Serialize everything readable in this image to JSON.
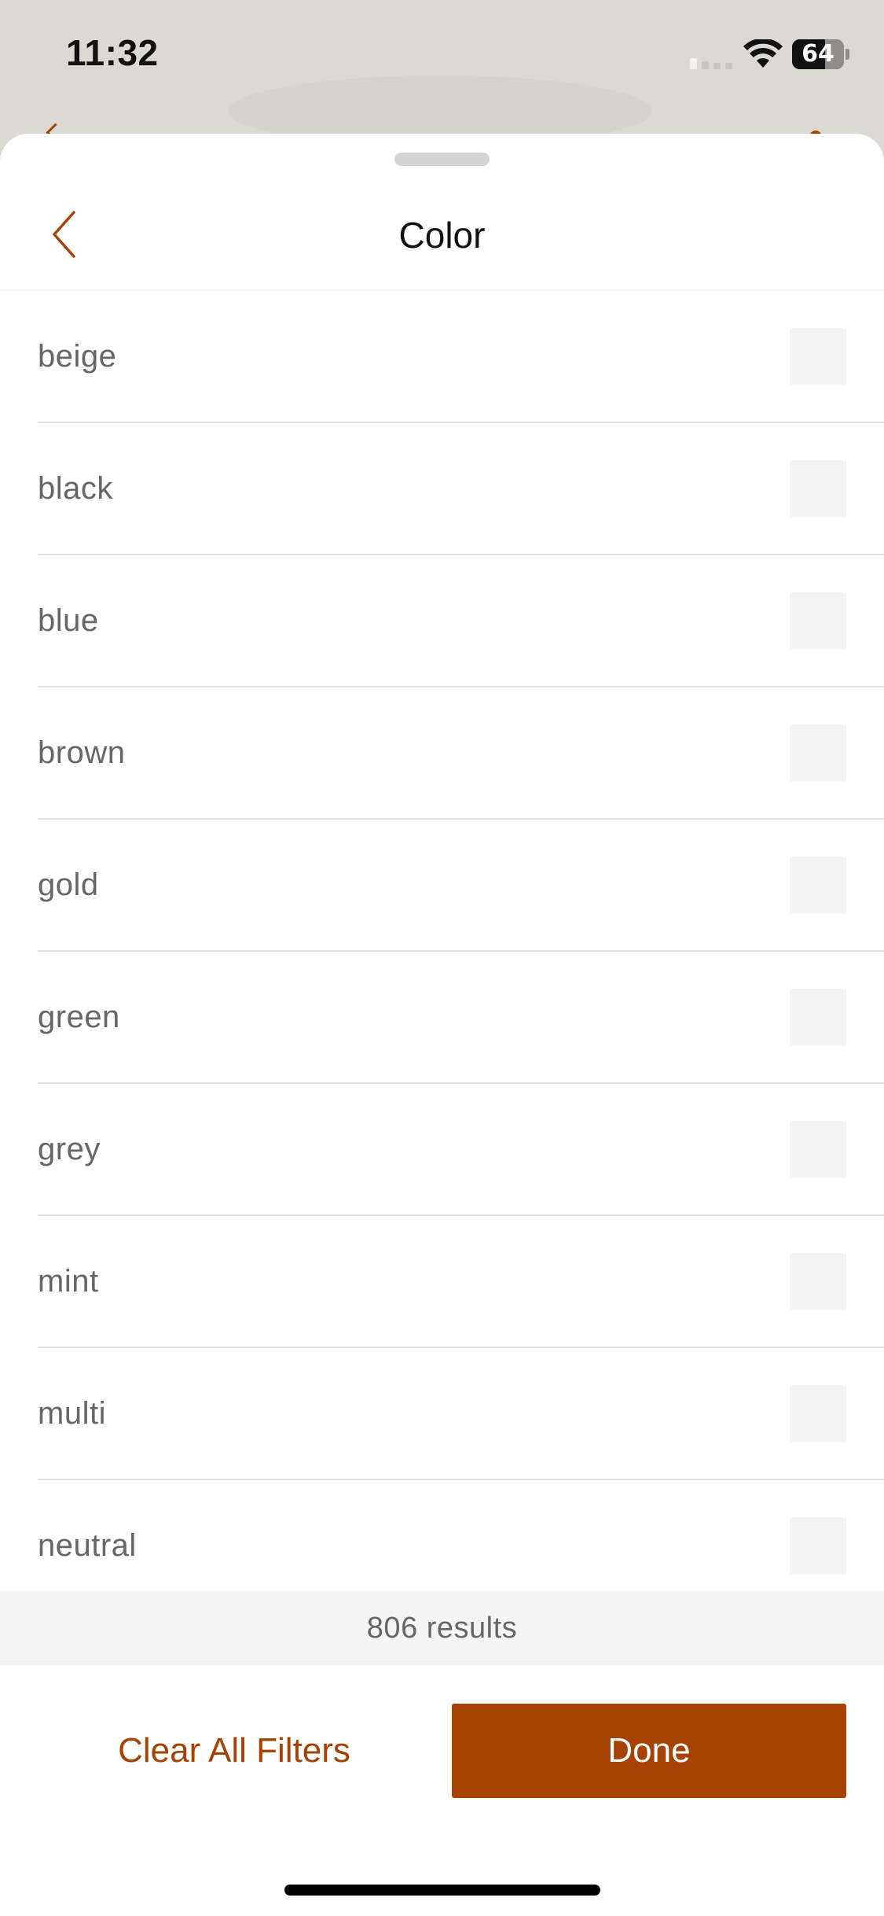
{
  "status_bar": {
    "time": "11:32",
    "battery_percent": 64,
    "battery_label": "64"
  },
  "header": {
    "title": "Color",
    "back_icon": "chevron-left-icon"
  },
  "colors": {
    "accent": "#a64304",
    "text": "#666666",
    "checkbox": "#f4f4f4"
  },
  "options": [
    {
      "label": "beige",
      "checked": false
    },
    {
      "label": "black",
      "checked": false
    },
    {
      "label": "blue",
      "checked": false
    },
    {
      "label": "brown",
      "checked": false
    },
    {
      "label": "gold",
      "checked": false
    },
    {
      "label": "green",
      "checked": false
    },
    {
      "label": "grey",
      "checked": false
    },
    {
      "label": "mint",
      "checked": false
    },
    {
      "label": "multi",
      "checked": false
    },
    {
      "label": "neutral",
      "checked": false
    }
  ],
  "results": {
    "text": "806 results"
  },
  "footer": {
    "clear_label": "Clear All Filters",
    "done_label": "Done"
  }
}
